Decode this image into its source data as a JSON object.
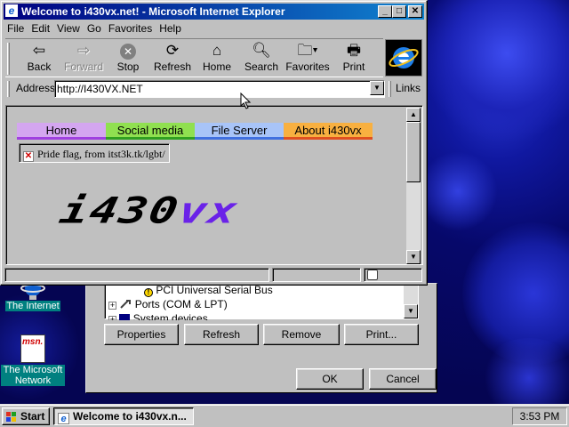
{
  "desktop": {
    "icons": [
      {
        "label": "The Internet",
        "icon": "internet-icon"
      },
      {
        "label": "The Microsoft Network",
        "icon": "msn-icon",
        "badge": "msn."
      }
    ]
  },
  "device_manager": {
    "tree_items": [
      {
        "label": "PCI Universal Serial Bus",
        "icon": "warning-device-icon"
      },
      {
        "label": "Ports (COM & LPT)",
        "icon": "port-icon",
        "expander": "+"
      },
      {
        "label": "System devices",
        "icon": "system-icon",
        "expander": "+"
      }
    ],
    "buttons": {
      "properties": "Properties",
      "refresh": "Refresh",
      "remove": "Remove",
      "print": "Print..."
    },
    "ok": "OK",
    "cancel": "Cancel"
  },
  "browser": {
    "title": "Welcome to i430vx.net! - Microsoft Internet Explorer",
    "menu": [
      "File",
      "Edit",
      "View",
      "Go",
      "Favorites",
      "Help"
    ],
    "toolbar": {
      "back": "Back",
      "forward": "Forward",
      "stop": "Stop",
      "refresh": "Refresh",
      "home": "Home",
      "search": "Search",
      "favorites": "Favorites",
      "print": "Print"
    },
    "address_label": "Address",
    "address_value": "http://I430VX.NET",
    "links_label": "Links",
    "page": {
      "nav": [
        {
          "label": "Home",
          "color": "#d4a6f0",
          "bar": "#a040e0"
        },
        {
          "label": "Social media",
          "color": "#90e050",
          "bar": "#30a020"
        },
        {
          "label": "File Server",
          "color": "#a8c4f8",
          "bar": "#4070e0"
        },
        {
          "label": "About i430vx",
          "color": "#f8b040",
          "bar": "#e05020"
        }
      ],
      "broken_image_alt": "Pride flag, from itst3k.tk/lgbt/",
      "logo_part1": "i430",
      "logo_part2": "vx"
    }
  },
  "taskbar": {
    "start_label": "Start",
    "task_label": "Welcome to i430vx.n...",
    "clock": "3:53 PM"
  }
}
